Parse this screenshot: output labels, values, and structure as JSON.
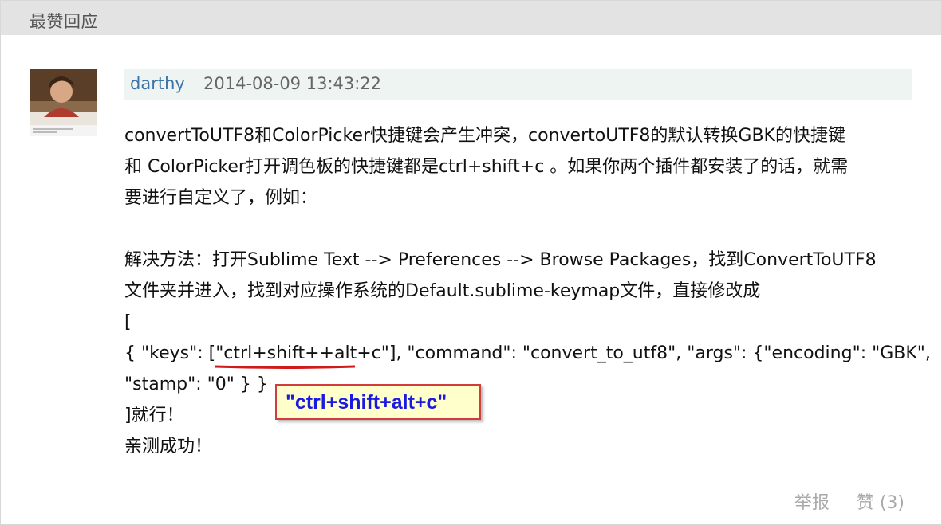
{
  "header": {
    "title": "最赞回应"
  },
  "comment": {
    "author": "darthy",
    "timestamp": "2014-08-09 13:43:22",
    "lines": [
      "convertToUTF8和ColorPicker快捷键会产生冲突，convertoUTF8的默认转换GBK的快捷键",
      "和 ColorPicker打开调色板的快捷键都是ctrl+shift+c 。如果你两个插件都安装了的话，就需",
      "要进行自定义了，例如：",
      "",
      "解决方法：打开Sublime Text --> Preferences --> Browse Packages，找到ConvertToUTF8",
      "文件夹并进入，找到对应操作系统的Default.sublime-keymap文件，直接修改成",
      "[",
      "{ \"keys\": [\"ctrl+shift++alt+c\"], \"command\": \"convert_to_utf8\", \"args\": {\"encoding\": \"GBK\",",
      "\"stamp\": \"0\" } }",
      "]就行！",
      "亲测成功！"
    ],
    "annotation": "\"ctrl+shift+alt+c\"",
    "annotation_colors": {
      "text": "#1a1ae0",
      "border": "#d13c3c",
      "fill": "#ffffcc",
      "underline": "#d11a1a"
    }
  },
  "actions": {
    "report": "举报",
    "like": "赞 (3)"
  }
}
